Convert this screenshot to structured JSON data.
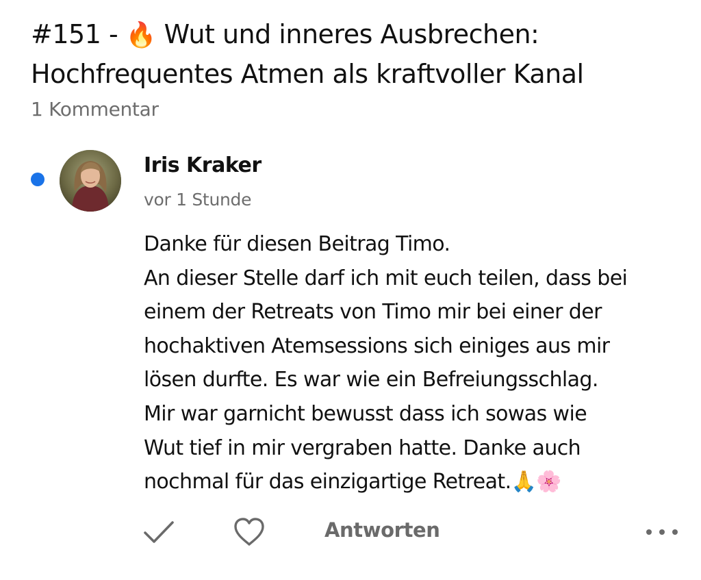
{
  "post": {
    "title_prefix": "#151 - ",
    "title_emoji": "🔥",
    "title_rest": " Wut und inneres Ausbrechen: Hochfrequentes Atmen als kraftvoller Kanal",
    "comment_count": "1 Kommentar"
  },
  "comment": {
    "author": "Iris Kraker",
    "time": "vor 1 Stunde",
    "unread": true,
    "body_lines": [
      "Danke für diesen Beitrag Timo.",
      "An dieser Stelle darf ich mit euch teilen, dass bei",
      "einem der Retreats von Timo mir bei einer der",
      "hochaktiven Atemsessions sich einiges aus mir",
      "lösen durfte. Es war wie ein Befreiungsschlag.",
      "Mir war garnicht bewusst dass ich sowas wie",
      "Wut tief in mir vergraben hatte.  Danke auch",
      "nochmal für das einzigartige Retreat.🙏🌸"
    ]
  },
  "actions": {
    "check_icon": "check-icon",
    "like_icon": "heart-icon",
    "reply_label": "Antworten",
    "more_icon": "more-dots-icon"
  },
  "colors": {
    "unread_dot": "#1a73e8",
    "secondary_text": "#6d6d6d",
    "icon_gray": "#6a6a6a"
  }
}
